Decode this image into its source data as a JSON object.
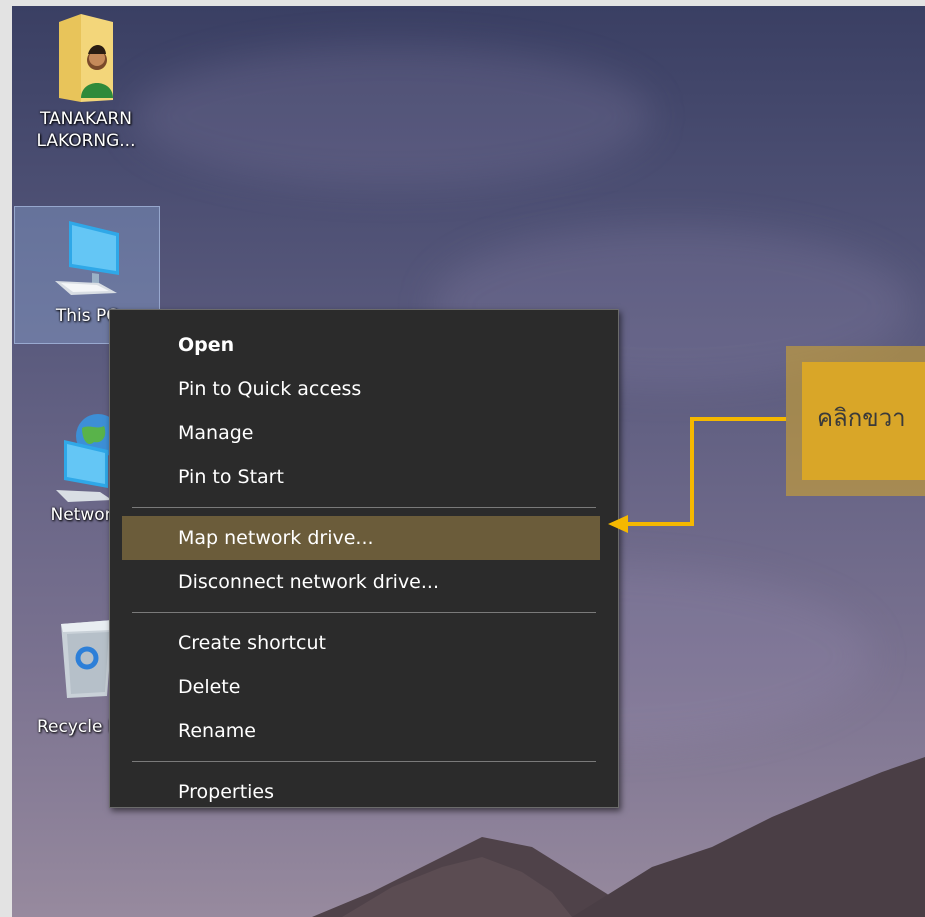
{
  "desktop": {
    "icons": [
      {
        "label": "TANAKARN\nLAKORNG...",
        "icon": "user-folder-icon"
      },
      {
        "label": "This PC",
        "icon": "computer-icon"
      },
      {
        "label": "Network",
        "icon": "network-icon"
      },
      {
        "label": "Recycle Bin",
        "icon": "recycle-bin-icon"
      }
    ]
  },
  "context_menu": {
    "items": [
      {
        "label": "Open",
        "bold": true
      },
      {
        "label": "Pin to Quick access"
      },
      {
        "label": "Manage"
      },
      {
        "label": "Pin to Start"
      },
      {
        "label": "Map network drive...",
        "highlighted": true
      },
      {
        "label": "Disconnect network drive..."
      },
      {
        "label": "Create shortcut"
      },
      {
        "label": "Delete"
      },
      {
        "label": "Rename"
      },
      {
        "label": "Properties"
      }
    ]
  },
  "annotation": {
    "text": "คลิกขวา",
    "color": "#d9a628",
    "arrow_color": "#f5b800"
  },
  "colors": {
    "menu_bg": "#2b2b2b",
    "menu_highlight": "#6b5c3a",
    "selection": "#96b4e6"
  }
}
